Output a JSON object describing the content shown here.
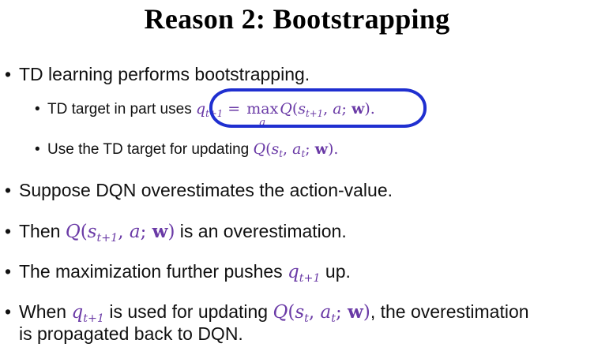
{
  "slide": {
    "title": "Reason 2: Bootstrapping",
    "bullet_symbol": "•",
    "bullets": {
      "b1": "TD learning performs bootstrapping.",
      "b1_sub1_text": "TD target in part uses ",
      "b1_sub2_text": "Use the TD target for updating ",
      "b2": "Suppose DQN overestimates the action-value.",
      "b3_pre": "Then ",
      "b3_post": " is an overestimation.",
      "b4_pre": "The maximization further pushes ",
      "b4_post": " up.",
      "b5_pre": "When ",
      "b5_mid": " is used for updating ",
      "b5_post": ", the overestimation",
      "b5_line2": "is propagated back to DQN."
    },
    "colors": {
      "math": "#6a3aa6",
      "circle": "#1f2fd0"
    }
  }
}
